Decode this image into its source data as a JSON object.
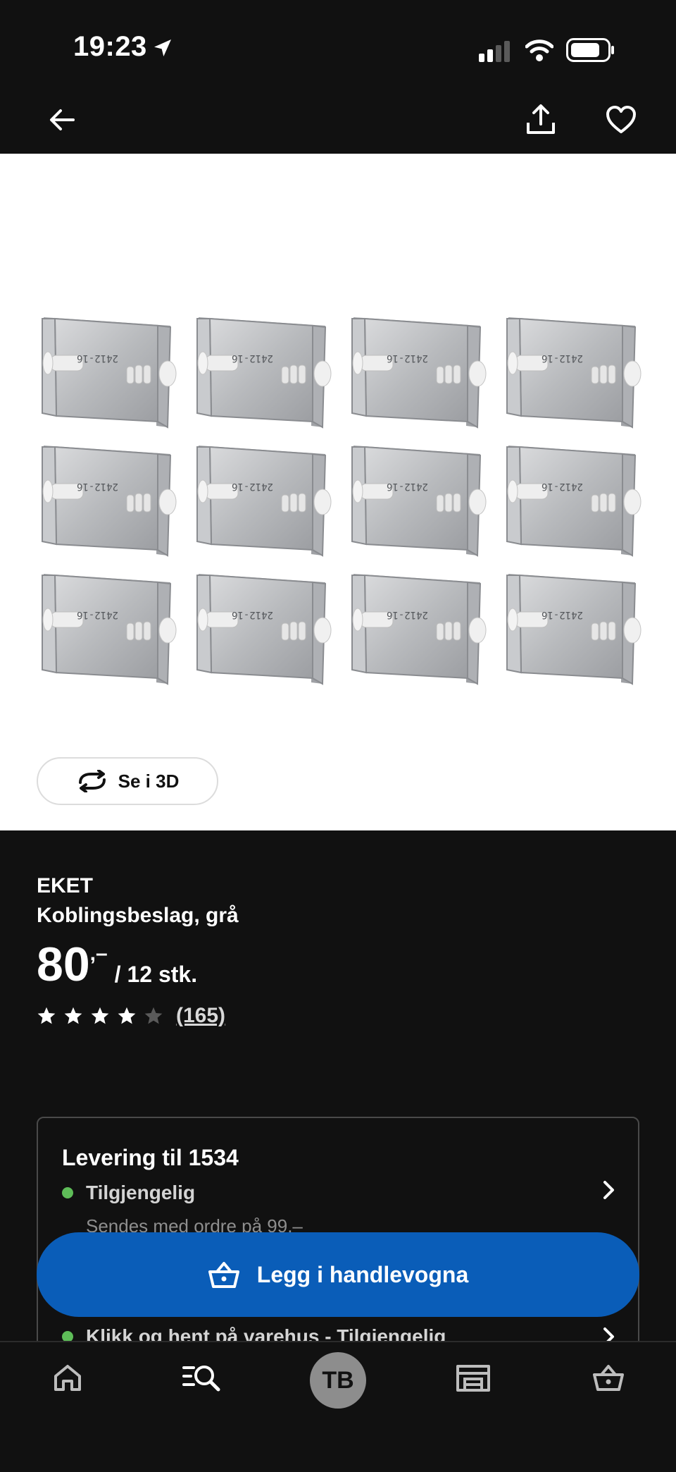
{
  "status_bar": {
    "time": "19:23",
    "icons": [
      "location-arrow-icon",
      "signal-icon",
      "wifi-icon",
      "battery-icon"
    ]
  },
  "nav": {
    "back": "back-arrow-icon",
    "share": "share-icon",
    "favorite": "heart-icon"
  },
  "image": {
    "alt_icon": "connecting-bracket-image",
    "see_3d_label": "Se i 3D"
  },
  "product": {
    "brand": "EKET",
    "description": "Koblingsbeslag, grå",
    "price": "80",
    "price_decimals": ",–",
    "price_unit": "/ 12 stk.",
    "rating": 4,
    "rating_max": 5,
    "review_count": "(165)"
  },
  "delivery": {
    "title": "Levering til 1534",
    "status": "Tilgjengelig",
    "note": "Sendes med ordre på 99,–",
    "pickup": "Klikk og hent på varehus - Tilgjengelig"
  },
  "cart_button": {
    "label": "Legg i handlevogna"
  },
  "tabbar": {
    "avatar_initials": "TB"
  },
  "colors": {
    "background": "#111111",
    "accent_blue": "#0a5db8",
    "available_green": "#5ebd58"
  }
}
